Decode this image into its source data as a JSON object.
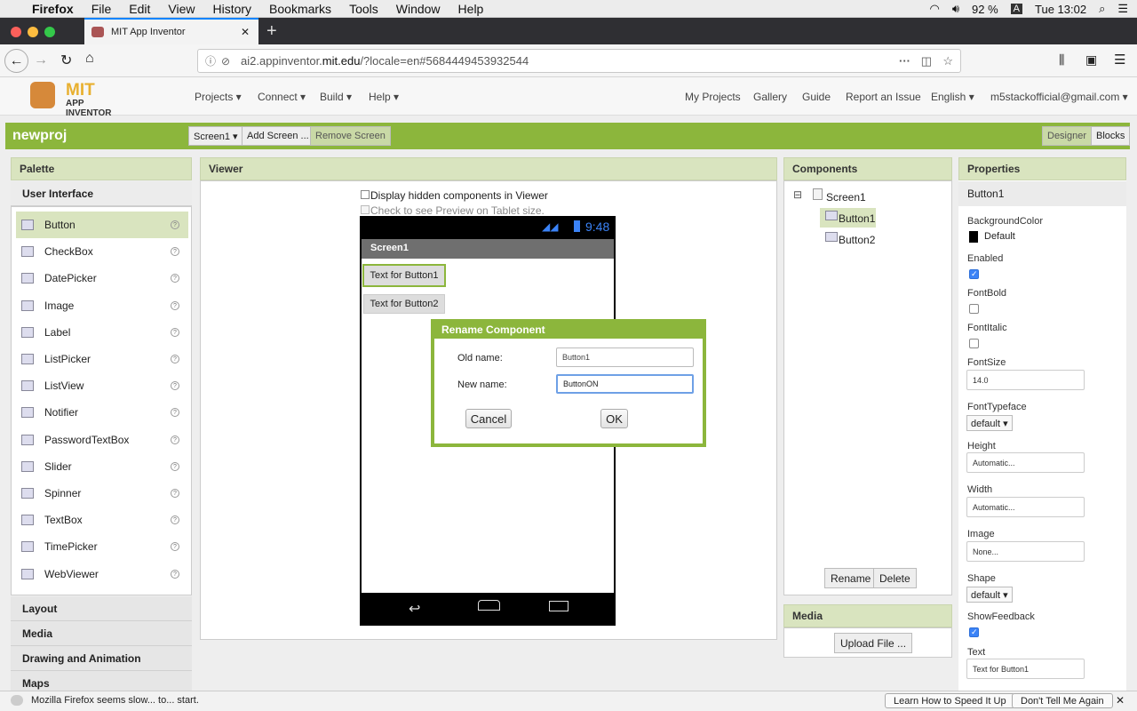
{
  "menubar": {
    "app": "Firefox",
    "items": [
      "File",
      "Edit",
      "View",
      "History",
      "Bookmarks",
      "Tools",
      "Window",
      "Help"
    ],
    "battery": "92 %",
    "input_source": "A",
    "clock": "Tue 13:02"
  },
  "browser": {
    "tab_title": "MIT App Inventor",
    "url_host_prefix": "ai2.appinventor.",
    "url_host": "mit.edu",
    "url_rest": "/?locale=en#5684449453932544"
  },
  "header": {
    "logo_mit": "MIT",
    "logo_sub": "APP INVENTOR",
    "menus": [
      "Projects ▾",
      "Connect ▾",
      "Build ▾",
      "Help ▾"
    ],
    "right_links": [
      "My Projects",
      "Gallery",
      "Guide",
      "Report an Issue",
      "English ▾",
      "m5stackofficial@gmail.com ▾"
    ]
  },
  "project": {
    "name": "newproj",
    "screen_select": "Screen1 ▾",
    "add_screen": "Add Screen ...",
    "remove_screen": "Remove Screen",
    "designer": "Designer",
    "blocks": "Blocks"
  },
  "palette": {
    "title": "Palette",
    "section": "User Interface",
    "items": [
      "Button",
      "CheckBox",
      "DatePicker",
      "Image",
      "Label",
      "ListPicker",
      "ListView",
      "Notifier",
      "PasswordTextBox",
      "Slider",
      "Spinner",
      "TextBox",
      "TimePicker",
      "WebViewer"
    ],
    "help_glyph": "?",
    "sections": [
      "Layout",
      "Media",
      "Drawing and Animation",
      "Maps"
    ]
  },
  "viewer": {
    "title": "Viewer",
    "check_hidden": "Display hidden components in Viewer",
    "check_tablet": "Check to see Preview on Tablet size.",
    "phone_time": "9:48",
    "screen_title": "Screen1",
    "button1_text": "Text for Button1",
    "button2_text": "Text for Button2"
  },
  "dialog": {
    "title": "Rename Component",
    "old_label": "Old name:",
    "old_value": "Button1",
    "new_label": "New name:",
    "new_value": "ButtonON",
    "cancel": "Cancel",
    "ok": "OK"
  },
  "components": {
    "title": "Components",
    "tree": [
      "Screen1",
      "Button1",
      "Button2"
    ],
    "collapse_glyph": "⊟",
    "rename": "Rename",
    "delete": "Delete",
    "media_title": "Media",
    "upload": "Upload File ..."
  },
  "properties": {
    "title": "Properties",
    "component": "Button1",
    "bgcolor_label": "BackgroundColor",
    "bgcolor_value": "Default",
    "enabled_label": "Enabled",
    "fontbold_label": "FontBold",
    "fontitalic_label": "FontItalic",
    "fontsize_label": "FontSize",
    "fontsize_value": "14.0",
    "typeface_label": "FontTypeface",
    "typeface_value": "default ▾",
    "height_label": "Height",
    "height_value": "Automatic...",
    "width_label": "Width",
    "width_value": "Automatic...",
    "image_label": "Image",
    "image_value": "None...",
    "shape_label": "Shape",
    "shape_value": "default ▾",
    "feedback_label": "ShowFeedback",
    "text_label": "Text",
    "text_value": "Text for Button1"
  },
  "statusbar": {
    "message": "Mozilla Firefox seems slow... to... start.",
    "learn": "Learn How to Speed It Up",
    "dont_tell": "Don't Tell Me Again",
    "close_glyph": "✕"
  },
  "colors": {
    "accent_green": "#8cb63c",
    "panel_header": "#d9e4bf",
    "focus_blue": "#3b83f7"
  }
}
